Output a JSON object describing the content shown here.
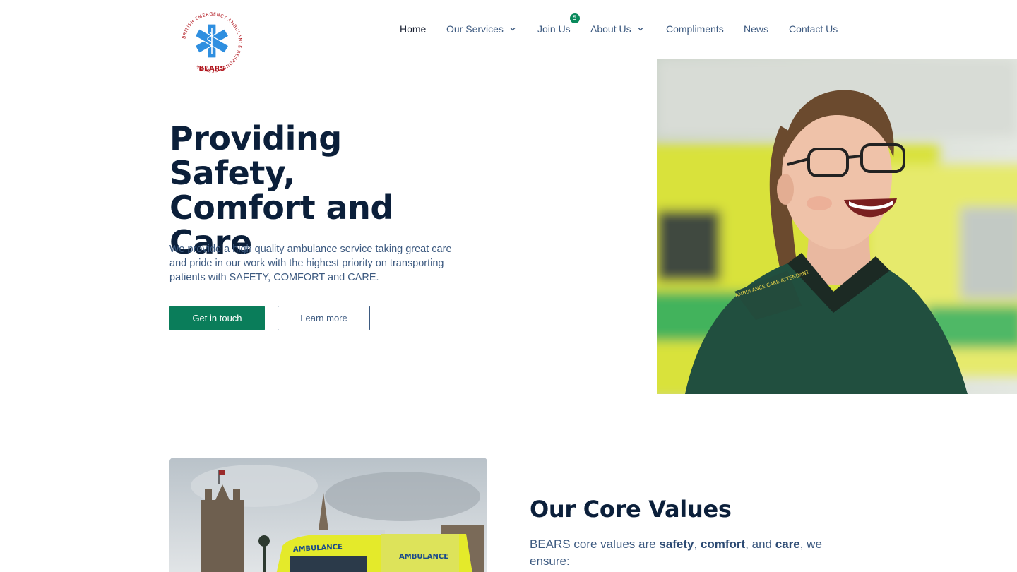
{
  "header": {
    "logo_text": "BEARS",
    "logo_ring_text": "BRITISH EMERGENCY AMBULANCE RESPONSE SERVICE",
    "nav": [
      {
        "label": "Home",
        "active": true,
        "dropdown": false
      },
      {
        "label": "Our Services",
        "active": false,
        "dropdown": true
      },
      {
        "label": "Join Us",
        "active": false,
        "dropdown": false,
        "badge": "5"
      },
      {
        "label": "About Us",
        "active": false,
        "dropdown": true
      },
      {
        "label": "Compliments",
        "active": false,
        "dropdown": false
      },
      {
        "label": "News",
        "active": false,
        "dropdown": false
      },
      {
        "label": "Contact Us",
        "active": false,
        "dropdown": false
      }
    ]
  },
  "hero": {
    "title_line1": "Providing Safety,",
    "title_line2": "Comfort and",
    "title_line3": "Care",
    "description": "We provide a high quality ambulance service taking great care and pride in our work with the highest priority on transporting patients with SAFETY, COMFORT and CARE.",
    "primary_button": "Get in touch",
    "secondary_button": "Learn more",
    "photo_badge_text": "AMBULANCE CARE ATTENDANT"
  },
  "values": {
    "title": "Our Core Values",
    "intro_prefix": "BEARS core values are ",
    "v1": "safety",
    "sep1": ", ",
    "v2": "comfort",
    "sep2": ", and ",
    "v3": "care",
    "intro_suffix": ", we ensure:",
    "ambulance_label": "AMBULANCE"
  },
  "colors": {
    "primary_green": "#0a7d5a",
    "navy": "#0b1f3a",
    "text_blue": "#3d5a80",
    "badge_green": "#0a8a5c"
  }
}
